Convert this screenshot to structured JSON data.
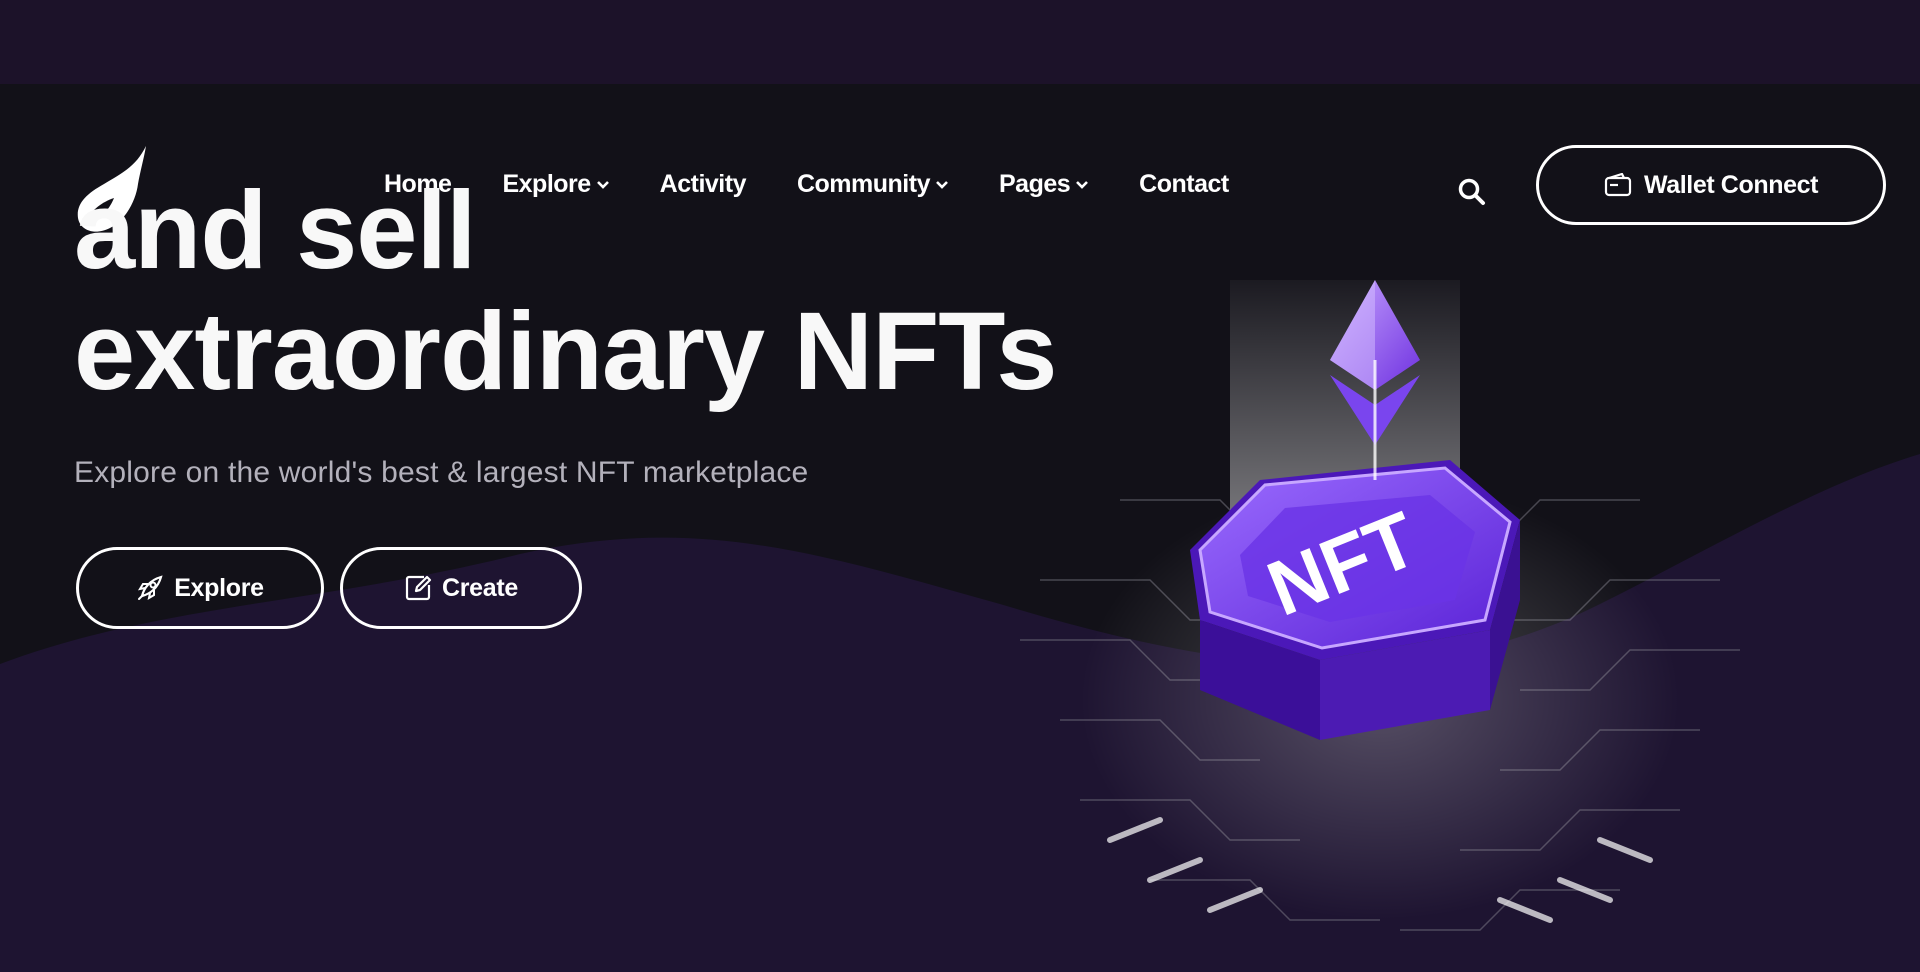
{
  "nav": {
    "items": [
      {
        "label": "Home",
        "dropdown": false
      },
      {
        "label": "Explore",
        "dropdown": true
      },
      {
        "label": "Activity",
        "dropdown": false
      },
      {
        "label": "Community",
        "dropdown": true
      },
      {
        "label": "Pages",
        "dropdown": true
      },
      {
        "label": "Contact",
        "dropdown": false
      }
    ],
    "search_icon": "search-icon",
    "wallet_label": "Wallet Connect",
    "wallet_icon": "wallet-icon"
  },
  "hero": {
    "line1": "and sell",
    "line2": "extraordinary NFTs",
    "subtitle": "Explore on the world's best & largest NFT marketplace",
    "explore_label": "Explore",
    "explore_icon": "rocket-icon",
    "create_label": "Create",
    "create_icon": "edit-icon",
    "art_text": "NFT"
  },
  "colors": {
    "background_top": "#1c1229",
    "background_dark": "#121118",
    "wave_purple": "#1e1431",
    "accent_purple": "#7b3cf0",
    "text_muted": "#b3b1bb"
  }
}
